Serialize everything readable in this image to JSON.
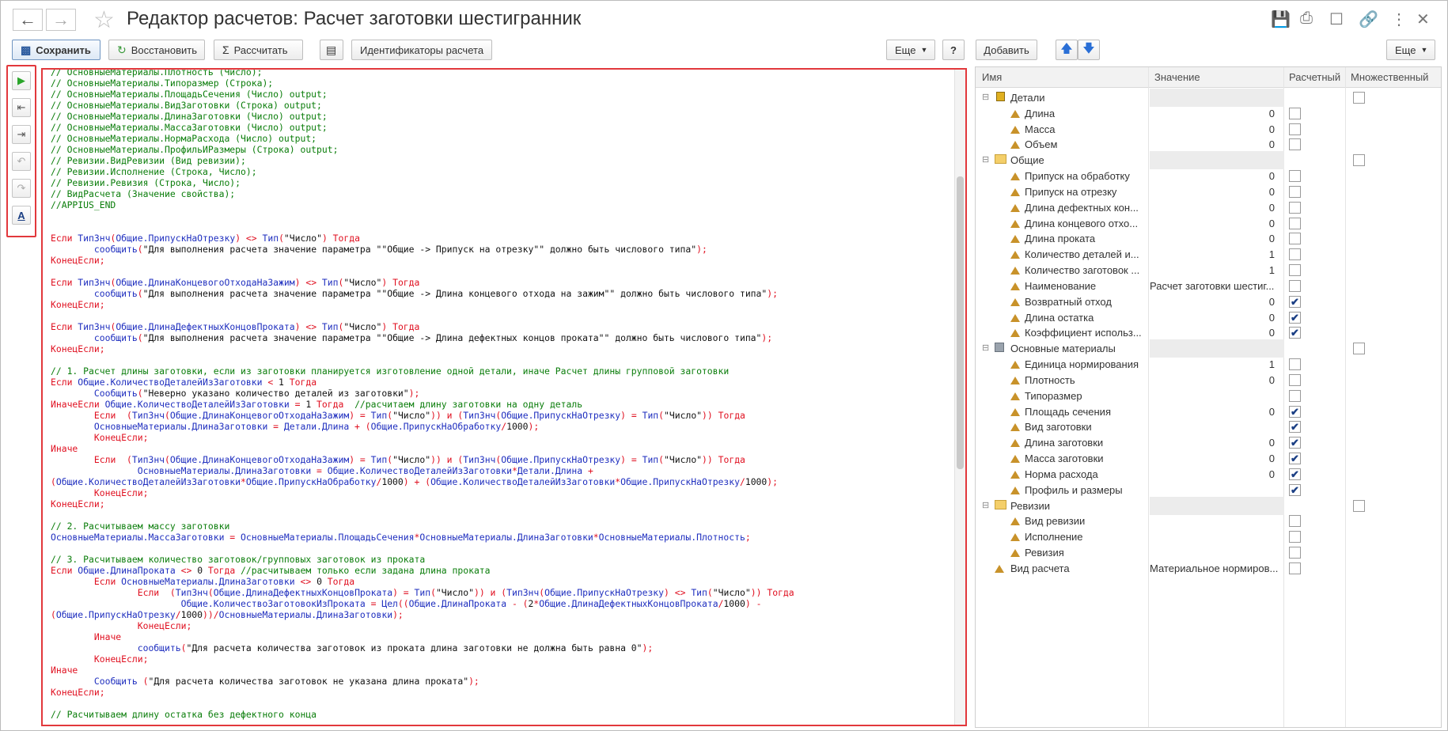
{
  "window": {
    "title": "Редактор расчетов: Расчет заготовки шестигранник"
  },
  "toolbar": {
    "save_label": "Сохранить",
    "restore_label": "Восстановить",
    "calculate_label": "Рассчитать",
    "identifiers_label": "Идентификаторы расчета",
    "more_label": "Еще",
    "help_label": "?",
    "add_label": "Добавить",
    "more_right_label": "Еще"
  },
  "grid": {
    "headers": {
      "name": "Имя",
      "value": "Значение",
      "calc": "Расчетный",
      "multiple": "Множественный"
    },
    "rows": [
      {
        "name": "Детали",
        "value": "",
        "calc": "none",
        "multi": "empty",
        "type": "group-cube",
        "level": 0
      },
      {
        "name": "Длина",
        "value": "0",
        "calc": "empty",
        "multi": "none",
        "type": "prop",
        "level": 1
      },
      {
        "name": "Масса",
        "value": "0",
        "calc": "empty",
        "multi": "none",
        "type": "prop",
        "level": 1
      },
      {
        "name": "Объем",
        "value": "0",
        "calc": "empty",
        "multi": "none",
        "type": "prop",
        "level": 1
      },
      {
        "name": "Общие",
        "value": "",
        "calc": "none",
        "multi": "empty",
        "type": "group-folder",
        "level": 0
      },
      {
        "name": "Припуск на обработку",
        "value": "0",
        "calc": "empty",
        "multi": "none",
        "type": "prop",
        "level": 1
      },
      {
        "name": "Припуск на отрезку",
        "value": "0",
        "calc": "empty",
        "multi": "none",
        "type": "prop",
        "level": 1
      },
      {
        "name": "Длина дефектных кон...",
        "value": "0",
        "calc": "empty",
        "multi": "none",
        "type": "prop",
        "level": 1
      },
      {
        "name": "Длина концевого отхо...",
        "value": "0",
        "calc": "empty",
        "multi": "none",
        "type": "prop",
        "level": 1
      },
      {
        "name": "Длина проката",
        "value": "0",
        "calc": "empty",
        "multi": "none",
        "type": "prop",
        "level": 1
      },
      {
        "name": "Количество деталей и...",
        "value": "1",
        "calc": "empty",
        "multi": "none",
        "type": "prop",
        "level": 1
      },
      {
        "name": "Количество заготовок ...",
        "value": "1",
        "calc": "empty",
        "multi": "none",
        "type": "prop",
        "level": 1
      },
      {
        "name": "Наименование",
        "value": "Расчет заготовки шестиг...",
        "calc": "empty",
        "multi": "none",
        "type": "prop",
        "level": 1,
        "text": true
      },
      {
        "name": "Возвратный отход",
        "value": "0",
        "calc": "checked",
        "multi": "none",
        "type": "prop",
        "level": 1
      },
      {
        "name": "Длина остатка",
        "value": "0",
        "calc": "checked",
        "multi": "none",
        "type": "prop",
        "level": 1
      },
      {
        "name": "Коэффициент использ...",
        "value": "0",
        "calc": "checked",
        "multi": "none",
        "type": "prop",
        "level": 1
      },
      {
        "name": "Основные материалы",
        "value": "",
        "calc": "none",
        "multi": "empty",
        "type": "group-box",
        "level": 0
      },
      {
        "name": "Единица нормирования",
        "value": "1",
        "calc": "empty",
        "multi": "none",
        "type": "prop",
        "level": 1
      },
      {
        "name": "Плотность",
        "value": "0",
        "calc": "empty",
        "multi": "none",
        "type": "prop",
        "level": 1
      },
      {
        "name": "Типоразмер",
        "value": "",
        "calc": "empty",
        "multi": "none",
        "type": "prop",
        "level": 1
      },
      {
        "name": "Площадь сечения",
        "value": "0",
        "calc": "checked",
        "multi": "none",
        "type": "prop",
        "level": 1
      },
      {
        "name": "Вид заготовки",
        "value": "",
        "calc": "checked",
        "multi": "none",
        "type": "prop",
        "level": 1
      },
      {
        "name": "Длина заготовки",
        "value": "0",
        "calc": "checked",
        "multi": "none",
        "type": "prop",
        "level": 1
      },
      {
        "name": "Масса заготовки",
        "value": "0",
        "calc": "checked",
        "multi": "none",
        "type": "prop",
        "level": 1
      },
      {
        "name": "Норма расхода",
        "value": "0",
        "calc": "checked",
        "multi": "none",
        "type": "prop",
        "level": 1
      },
      {
        "name": "Профиль и размеры",
        "value": "",
        "calc": "checked",
        "multi": "none",
        "type": "prop",
        "level": 1
      },
      {
        "name": "Ревизии",
        "value": "",
        "calc": "none",
        "multi": "empty",
        "type": "group-folder",
        "level": 0
      },
      {
        "name": "Вид ревизии",
        "value": "",
        "calc": "empty",
        "multi": "none",
        "type": "prop",
        "level": 1
      },
      {
        "name": "Исполнение",
        "value": "",
        "calc": "empty",
        "multi": "none",
        "type": "prop",
        "level": 1
      },
      {
        "name": "Ревизия",
        "value": "",
        "calc": "empty",
        "multi": "none",
        "type": "prop",
        "level": 1
      },
      {
        "name": "Вид расчета",
        "value": "Материальное нормиров...",
        "calc": "empty",
        "multi": "none",
        "type": "prop",
        "level": 0,
        "text": true
      }
    ]
  },
  "code_lines": [
    [
      [
        "c",
        "// ОсновныеМатериалы.Плотность (Число);"
      ]
    ],
    [
      [
        "c",
        "// ОсновныеМатериалы.Типоразмер (Строка);"
      ]
    ],
    [
      [
        "c",
        "// ОсновныеМатериалы.ПлощадьСечения (Число) output;"
      ]
    ],
    [
      [
        "c",
        "// ОсновныеМатериалы.ВидЗаготовки (Строка) output;"
      ]
    ],
    [
      [
        "c",
        "// ОсновныеМатериалы.ДлинаЗаготовки (Число) output;"
      ]
    ],
    [
      [
        "c",
        "// ОсновныеМатериалы.МассаЗаготовки (Число) output;"
      ]
    ],
    [
      [
        "c",
        "// ОсновныеМатериалы.НормаРасхода (Число) output;"
      ]
    ],
    [
      [
        "c",
        "// ОсновныеМатериалы.ПрофильИРазмеры (Строка) output;"
      ]
    ],
    [
      [
        "c",
        "// Ревизии.ВидРевизии (Вид ревизии);"
      ]
    ],
    [
      [
        "c",
        "// Ревизии.Исполнение (Строка, Число);"
      ]
    ],
    [
      [
        "c",
        "// Ревизии.Ревизия (Строка, Число);"
      ]
    ],
    [
      [
        "c",
        "// ВидРасчета (Значение свойства);"
      ]
    ],
    [
      [
        "c",
        "//APPIUS_END"
      ]
    ],
    [],
    [],
    [
      [
        "k",
        "Если "
      ],
      [
        "n",
        "ТипЗнч"
      ],
      [
        "k",
        "("
      ],
      [
        "n",
        "Общие.ПрипускНаОтрезку"
      ],
      [
        "k",
        ") <> "
      ],
      [
        "n",
        "Тип"
      ],
      [
        "k",
        "("
      ],
      [
        "s",
        "\"Число\""
      ],
      [
        "k",
        ") Тогда"
      ]
    ],
    [
      [
        "s",
        "        "
      ],
      [
        "n",
        "сообщить"
      ],
      [
        "k",
        "("
      ],
      [
        "s",
        "\"Для выполнения расчета значение параметра \"\"Общие -> Припуск на отрезку\"\" должно быть числового типа\""
      ],
      [
        "k",
        ");"
      ]
    ],
    [
      [
        "k",
        "КонецЕсли;"
      ]
    ],
    [],
    [
      [
        "k",
        "Если "
      ],
      [
        "n",
        "ТипЗнч"
      ],
      [
        "k",
        "("
      ],
      [
        "n",
        "Общие.ДлинаКонцевогоОтходаНаЗажим"
      ],
      [
        "k",
        ") <> "
      ],
      [
        "n",
        "Тип"
      ],
      [
        "k",
        "("
      ],
      [
        "s",
        "\"Число\""
      ],
      [
        "k",
        ") Тогда"
      ]
    ],
    [
      [
        "s",
        "        "
      ],
      [
        "n",
        "сообщить"
      ],
      [
        "k",
        "("
      ],
      [
        "s",
        "\"Для выполнения расчета значение параметра \"\"Общие -> Длина концевого отхода на зажим\"\" должно быть числового типа\""
      ],
      [
        "k",
        ");"
      ]
    ],
    [
      [
        "k",
        "КонецЕсли;"
      ]
    ],
    [],
    [
      [
        "k",
        "Если "
      ],
      [
        "n",
        "ТипЗнч"
      ],
      [
        "k",
        "("
      ],
      [
        "n",
        "Общие.ДлинаДефектныхКонцовПроката"
      ],
      [
        "k",
        ") <> "
      ],
      [
        "n",
        "Тип"
      ],
      [
        "k",
        "("
      ],
      [
        "s",
        "\"Число\""
      ],
      [
        "k",
        ") Тогда"
      ]
    ],
    [
      [
        "s",
        "        "
      ],
      [
        "n",
        "сообщить"
      ],
      [
        "k",
        "("
      ],
      [
        "s",
        "\"Для выполнения расчета значение параметра \"\"Общие -> Длина дефектных концов проката\"\" должно быть числового типа\""
      ],
      [
        "k",
        ");"
      ]
    ],
    [
      [
        "k",
        "КонецЕсли;"
      ]
    ],
    [],
    [
      [
        "c",
        "// 1. Расчет длины заготовки, если из заготовки планируется изготовление одной детали, иначе Расчет длины групповой заготовки"
      ]
    ],
    [
      [
        "k",
        "Если "
      ],
      [
        "n",
        "Общие.КоличествоДеталейИзЗаготовки"
      ],
      [
        "k",
        " < "
      ],
      [
        "s",
        "1"
      ],
      [
        "k",
        " Тогда"
      ]
    ],
    [
      [
        "s",
        "        "
      ],
      [
        "n",
        "Сообщить"
      ],
      [
        "k",
        "("
      ],
      [
        "s",
        "\"Неверно указано количество деталей из заготовки\""
      ],
      [
        "k",
        ");"
      ]
    ],
    [
      [
        "k",
        "ИначеЕсли "
      ],
      [
        "n",
        "Общие.КоличествоДеталейИзЗаготовки"
      ],
      [
        "k",
        " = "
      ],
      [
        "s",
        "1"
      ],
      [
        "k",
        " Тогда  "
      ],
      [
        "c",
        "//расчитаем длину заготовки на одну деталь"
      ]
    ],
    [
      [
        "s",
        "        "
      ],
      [
        "k",
        "Если  ("
      ],
      [
        "n",
        "ТипЗнч"
      ],
      [
        "k",
        "("
      ],
      [
        "n",
        "Общие.ДлинаКонцевогоОтходаНаЗажим"
      ],
      [
        "k",
        ") = "
      ],
      [
        "n",
        "Тип"
      ],
      [
        "k",
        "("
      ],
      [
        "s",
        "\"Число\""
      ],
      [
        "k",
        ")) и ("
      ],
      [
        "n",
        "ТипЗнч"
      ],
      [
        "k",
        "("
      ],
      [
        "n",
        "Общие.ПрипускНаОтрезку"
      ],
      [
        "k",
        ") = "
      ],
      [
        "n",
        "Тип"
      ],
      [
        "k",
        "("
      ],
      [
        "s",
        "\"Число\""
      ],
      [
        "k",
        ")) Тогда"
      ]
    ],
    [
      [
        "s",
        "        "
      ],
      [
        "n",
        "ОсновныеМатериалы.ДлинаЗаготовки"
      ],
      [
        "k",
        " = "
      ],
      [
        "n",
        "Детали.Длина"
      ],
      [
        "k",
        " + ("
      ],
      [
        "n",
        "Общие.ПрипускНаОбработку"
      ],
      [
        "k",
        "/"
      ],
      [
        "s",
        "1000"
      ],
      [
        "k",
        ");"
      ]
    ],
    [
      [
        "s",
        "        "
      ],
      [
        "k",
        "КонецЕсли;"
      ]
    ],
    [
      [
        "k",
        "Иначе"
      ]
    ],
    [
      [
        "s",
        "        "
      ],
      [
        "k",
        "Если  ("
      ],
      [
        "n",
        "ТипЗнч"
      ],
      [
        "k",
        "("
      ],
      [
        "n",
        "Общие.ДлинаКонцевогоОтходаНаЗажим"
      ],
      [
        "k",
        ") = "
      ],
      [
        "n",
        "Тип"
      ],
      [
        "k",
        "("
      ],
      [
        "s",
        "\"Число\""
      ],
      [
        "k",
        ")) и ("
      ],
      [
        "n",
        "ТипЗнч"
      ],
      [
        "k",
        "("
      ],
      [
        "n",
        "Общие.ПрипускНаОтрезку"
      ],
      [
        "k",
        ") = "
      ],
      [
        "n",
        "Тип"
      ],
      [
        "k",
        "("
      ],
      [
        "s",
        "\"Число\""
      ],
      [
        "k",
        ")) Тогда"
      ]
    ],
    [
      [
        "s",
        "                "
      ],
      [
        "n",
        "ОсновныеМатериалы.ДлинаЗаготовки"
      ],
      [
        "k",
        " = "
      ],
      [
        "n",
        "Общие.КоличествоДеталейИзЗаготовки"
      ],
      [
        "k",
        "*"
      ],
      [
        "n",
        "Детали.Длина"
      ],
      [
        "k",
        " +"
      ]
    ],
    [
      [
        "k",
        "("
      ],
      [
        "n",
        "Общие.КоличествоДеталейИзЗаготовки"
      ],
      [
        "k",
        "*"
      ],
      [
        "n",
        "Общие.ПрипускНаОбработку"
      ],
      [
        "k",
        "/"
      ],
      [
        "s",
        "1000"
      ],
      [
        "k",
        ") + ("
      ],
      [
        "n",
        "Общие.КоличествоДеталейИзЗаготовки"
      ],
      [
        "k",
        "*"
      ],
      [
        "n",
        "Общие.ПрипускНаОтрезку"
      ],
      [
        "k",
        "/"
      ],
      [
        "s",
        "1000"
      ],
      [
        "k",
        ");"
      ]
    ],
    [
      [
        "s",
        "        "
      ],
      [
        "k",
        "КонецЕсли;"
      ]
    ],
    [
      [
        "k",
        "КонецЕсли;"
      ]
    ],
    [],
    [
      [
        "c",
        "// 2. Расчитываем массу заготовки"
      ]
    ],
    [
      [
        "n",
        "ОсновныеМатериалы.МассаЗаготовки"
      ],
      [
        "k",
        " = "
      ],
      [
        "n",
        "ОсновныеМатериалы.ПлощадьСечения"
      ],
      [
        "k",
        "*"
      ],
      [
        "n",
        "ОсновныеМатериалы.ДлинаЗаготовки"
      ],
      [
        "k",
        "*"
      ],
      [
        "n",
        "ОсновныеМатериалы.Плотность"
      ],
      [
        "k",
        ";"
      ]
    ],
    [],
    [
      [
        "c",
        "// 3. Расчитываем количество заготовок/групповых заготовок из проката"
      ]
    ],
    [
      [
        "k",
        "Если "
      ],
      [
        "n",
        "Общие.ДлинаПроката"
      ],
      [
        "k",
        " <> "
      ],
      [
        "s",
        "0"
      ],
      [
        "k",
        " Тогда "
      ],
      [
        "c",
        "//расчитываем только если задана длина проката"
      ]
    ],
    [
      [
        "s",
        "        "
      ],
      [
        "k",
        "Если "
      ],
      [
        "n",
        "ОсновныеМатериалы.ДлинаЗаготовки"
      ],
      [
        "k",
        " <> "
      ],
      [
        "s",
        "0"
      ],
      [
        "k",
        " Тогда"
      ]
    ],
    [
      [
        "s",
        "                "
      ],
      [
        "k",
        "Если  ("
      ],
      [
        "n",
        "ТипЗнч"
      ],
      [
        "k",
        "("
      ],
      [
        "n",
        "Общие.ДлинаДефектныхКонцовПроката"
      ],
      [
        "k",
        ") = "
      ],
      [
        "n",
        "Тип"
      ],
      [
        "k",
        "("
      ],
      [
        "s",
        "\"Число\""
      ],
      [
        "k",
        ")) и ("
      ],
      [
        "n",
        "ТипЗнч"
      ],
      [
        "k",
        "("
      ],
      [
        "n",
        "Общие.ПрипускНаОтрезку"
      ],
      [
        "k",
        ") <> "
      ],
      [
        "n",
        "Тип"
      ],
      [
        "k",
        "("
      ],
      [
        "s",
        "\"Число\""
      ],
      [
        "k",
        ")) Тогда"
      ]
    ],
    [
      [
        "s",
        "                        "
      ],
      [
        "n",
        "Общие.КоличествоЗаготовокИзПроката"
      ],
      [
        "k",
        " = "
      ],
      [
        "n",
        "Цел"
      ],
      [
        "k",
        "(("
      ],
      [
        "n",
        "Общие.ДлинаПроката"
      ],
      [
        "k",
        " - ("
      ],
      [
        "s",
        "2"
      ],
      [
        "k",
        "*"
      ],
      [
        "n",
        "Общие.ДлинаДефектныхКонцовПроката"
      ],
      [
        "k",
        "/"
      ],
      [
        "s",
        "1000"
      ],
      [
        "k",
        ") -"
      ]
    ],
    [
      [
        "k",
        "("
      ],
      [
        "n",
        "Общие.ПрипускНаОтрезку"
      ],
      [
        "k",
        "/"
      ],
      [
        "s",
        "1000"
      ],
      [
        "k",
        "))/"
      ],
      [
        "n",
        "ОсновныеМатериалы.ДлинаЗаготовки"
      ],
      [
        "k",
        ");"
      ]
    ],
    [
      [
        "s",
        "                "
      ],
      [
        "k",
        "КонецЕсли;"
      ]
    ],
    [
      [
        "s",
        "        "
      ],
      [
        "k",
        "Иначе"
      ]
    ],
    [
      [
        "s",
        "                "
      ],
      [
        "n",
        "сообщить"
      ],
      [
        "k",
        "("
      ],
      [
        "s",
        "\"Для расчета количества заготовок из проката длина заготовки не должна быть равна 0\""
      ],
      [
        "k",
        ");"
      ]
    ],
    [
      [
        "s",
        "        "
      ],
      [
        "k",
        "КонецЕсли;"
      ]
    ],
    [
      [
        "k",
        "Иначе"
      ]
    ],
    [
      [
        "s",
        "        "
      ],
      [
        "n",
        "Сообщить"
      ],
      [
        "k",
        " ("
      ],
      [
        "s",
        "\"Для расчета количества заготовок не указана длина проката\""
      ],
      [
        "k",
        ");"
      ]
    ],
    [
      [
        "k",
        "КонецЕсли;"
      ]
    ],
    [],
    [
      [
        "c",
        "// Расчитываем длину остатка без дефектного конца"
      ]
    ]
  ]
}
